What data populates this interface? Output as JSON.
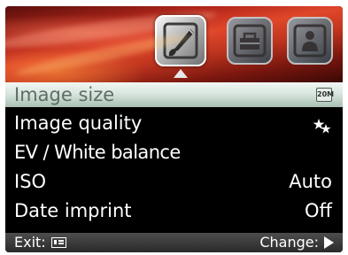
{
  "header": {
    "tabs": [
      {
        "icon": "brush-icon",
        "active": true
      },
      {
        "icon": "toolbox-icon",
        "active": false
      },
      {
        "icon": "person-settings-icon",
        "active": false
      }
    ]
  },
  "menu": {
    "items": [
      {
        "label": "Image size",
        "value": "20M",
        "value_icon": "image-size-icon",
        "selected": true
      },
      {
        "label": "Image quality",
        "value": "",
        "value_icon": "quality-stars-icon",
        "selected": false
      },
      {
        "label": "EV / White balance",
        "value": "",
        "selected": false
      },
      {
        "label": "ISO",
        "value": "Auto",
        "selected": false
      },
      {
        "label": "Date imprint",
        "value": "Off",
        "selected": false
      }
    ]
  },
  "footer": {
    "exit_label": "Exit:",
    "exit_icon": "menu-key-icon",
    "change_label": "Change:",
    "change_icon": "right-arrow-icon"
  },
  "colors": {
    "header_red": "#c2361f",
    "selection_bg": "#d9e6df",
    "selection_text": "#5e6e64",
    "menu_bg": "#000000",
    "footer_bg": "#3a3a3a"
  }
}
